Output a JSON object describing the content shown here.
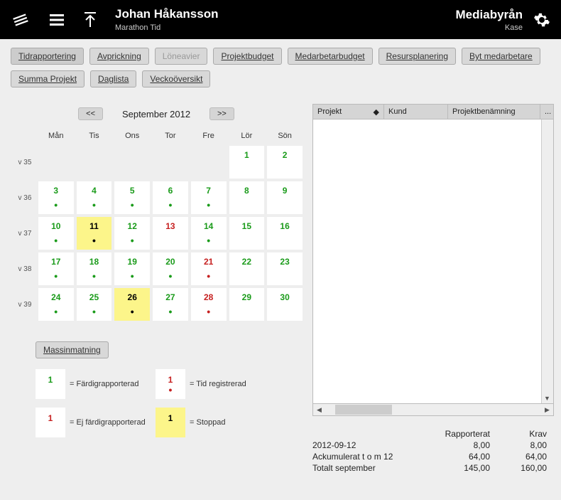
{
  "header": {
    "user_name": "Johan Håkansson",
    "subtitle": "Marathon Tid",
    "company": "Mediabyrån",
    "sub": "Kase"
  },
  "tabs": {
    "row1": [
      "Tidrapportering",
      "Avprickning",
      "Löneavier",
      "Projektbudget",
      "Medarbetarbudget",
      "Resursplanering",
      "Byt medarbetare"
    ],
    "row2": [
      "Summa Projekt",
      "Daglista",
      "Veckoöversikt"
    ]
  },
  "calendar": {
    "prev": "<<",
    "next": ">>",
    "month_label": "September 2012",
    "day_headers": [
      "Mån",
      "Tis",
      "Ons",
      "Tor",
      "Fre",
      "Lör",
      "Sön"
    ],
    "weeks": [
      {
        "num": "v 35",
        "days": [
          null,
          null,
          null,
          null,
          null,
          {
            "d": "1",
            "c": "green"
          },
          {
            "d": "2",
            "c": "green"
          }
        ]
      },
      {
        "num": "v 36",
        "days": [
          {
            "d": "3",
            "c": "green",
            "dot": "green"
          },
          {
            "d": "4",
            "c": "green",
            "dot": "green"
          },
          {
            "d": "5",
            "c": "green",
            "dot": "green"
          },
          {
            "d": "6",
            "c": "green",
            "dot": "green"
          },
          {
            "d": "7",
            "c": "green",
            "dot": "green"
          },
          {
            "d": "8",
            "c": "green"
          },
          {
            "d": "9",
            "c": "green"
          }
        ]
      },
      {
        "num": "v 37",
        "days": [
          {
            "d": "10",
            "c": "green",
            "dot": "green"
          },
          {
            "d": "11",
            "c": "black",
            "dot": "black",
            "bg": "yellow"
          },
          {
            "d": "12",
            "c": "green",
            "dot": "green"
          },
          {
            "d": "13",
            "c": "red"
          },
          {
            "d": "14",
            "c": "green",
            "dot": "green"
          },
          {
            "d": "15",
            "c": "green"
          },
          {
            "d": "16",
            "c": "green"
          }
        ]
      },
      {
        "num": "v 38",
        "days": [
          {
            "d": "17",
            "c": "green",
            "dot": "green"
          },
          {
            "d": "18",
            "c": "green",
            "dot": "green"
          },
          {
            "d": "19",
            "c": "green",
            "dot": "green"
          },
          {
            "d": "20",
            "c": "green",
            "dot": "green"
          },
          {
            "d": "21",
            "c": "red",
            "dot": "red"
          },
          {
            "d": "22",
            "c": "green"
          },
          {
            "d": "23",
            "c": "green"
          }
        ]
      },
      {
        "num": "v 39",
        "days": [
          {
            "d": "24",
            "c": "green",
            "dot": "green"
          },
          {
            "d": "25",
            "c": "green",
            "dot": "green"
          },
          {
            "d": "26",
            "c": "black",
            "dot": "black",
            "bg": "yellow"
          },
          {
            "d": "27",
            "c": "green",
            "dot": "green"
          },
          {
            "d": "28",
            "c": "red",
            "dot": "red"
          },
          {
            "d": "29",
            "c": "green"
          },
          {
            "d": "30",
            "c": "green"
          }
        ]
      }
    ]
  },
  "massin_label": "Massinmatning",
  "legend": {
    "done": {
      "num": "1",
      "text": "= Färdigrapporterad"
    },
    "reg": {
      "num": "1",
      "text": "= Tid registrerad"
    },
    "notdone": {
      "num": "1",
      "text": "= Ej färdigrapporterad"
    },
    "stopped": {
      "num": "1",
      "text": "= Stoppad"
    }
  },
  "table": {
    "col_projekt": "Projekt",
    "col_kund": "Kund",
    "col_ben": "Projektbenämning",
    "dots": "..."
  },
  "summary": {
    "h_rapp": "Rapporterat",
    "h_krav": "Krav",
    "rows": [
      {
        "label": "2012-09-12",
        "rapp": "8,00",
        "krav": "8,00"
      },
      {
        "label": "Ackumulerat t o m 12",
        "rapp": "64,00",
        "krav": "64,00"
      },
      {
        "label": "Totalt september",
        "rapp": "145,00",
        "krav": "160,00"
      }
    ]
  }
}
